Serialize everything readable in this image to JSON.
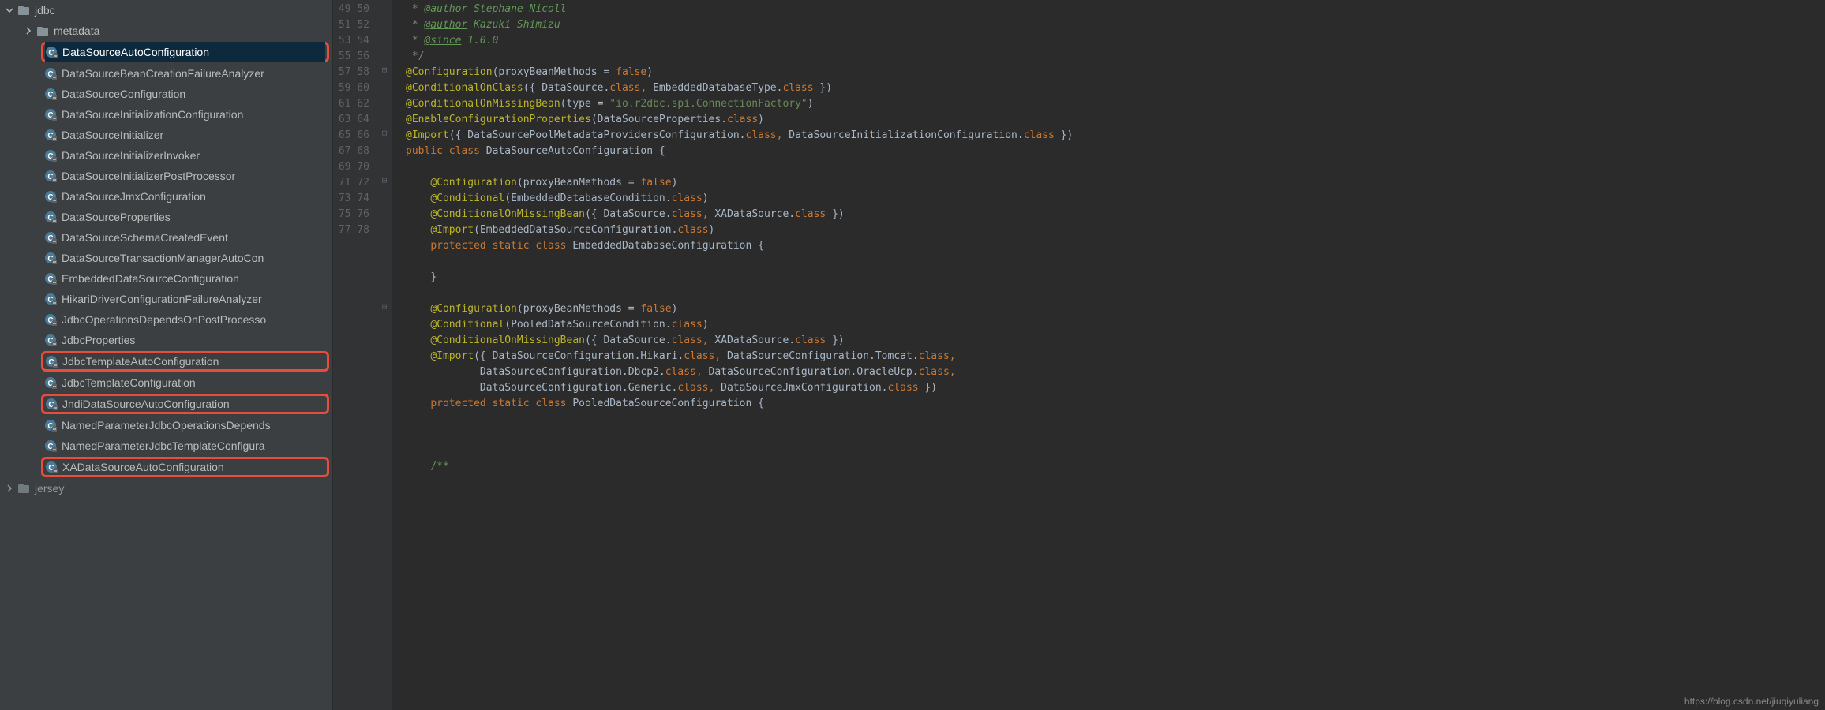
{
  "sidebar": {
    "root": {
      "label": "jdbc",
      "expanded": true
    },
    "folder": {
      "label": "metadata",
      "expanded": false
    },
    "items": [
      {
        "label": "DataSourceAutoConfiguration",
        "selected": true,
        "highlighted": true
      },
      {
        "label": "DataSourceBeanCreationFailureAnalyzer"
      },
      {
        "label": "DataSourceConfiguration"
      },
      {
        "label": "DataSourceInitializationConfiguration"
      },
      {
        "label": "DataSourceInitializer"
      },
      {
        "label": "DataSourceInitializerInvoker"
      },
      {
        "label": "DataSourceInitializerPostProcessor"
      },
      {
        "label": "DataSourceJmxConfiguration"
      },
      {
        "label": "DataSourceProperties"
      },
      {
        "label": "DataSourceSchemaCreatedEvent"
      },
      {
        "label": "DataSourceTransactionManagerAutoCon"
      },
      {
        "label": "EmbeddedDataSourceConfiguration"
      },
      {
        "label": "HikariDriverConfigurationFailureAnalyzer"
      },
      {
        "label": "JdbcOperationsDependsOnPostProcesso"
      },
      {
        "label": "JdbcProperties"
      },
      {
        "label": "JdbcTemplateAutoConfiguration",
        "highlighted": true
      },
      {
        "label": "JdbcTemplateConfiguration"
      },
      {
        "label": "JndiDataSourceAutoConfiguration",
        "highlighted": true
      },
      {
        "label": "NamedParameterJdbcOperationsDepends"
      },
      {
        "label": "NamedParameterJdbcTemplateConfigura"
      },
      {
        "label": "XADataSourceAutoConfiguration",
        "highlighted": true
      }
    ],
    "bottom": {
      "label": "jersey"
    }
  },
  "editor": {
    "startLine": 49,
    "endLine": 78,
    "code": {
      "l49": {
        "prefix": " * ",
        "tag": "@author",
        "val": " Stephane Nicoll"
      },
      "l50": {
        "prefix": " * ",
        "tag": "@author",
        "val": " Kazuki Shimizu"
      },
      "l51": {
        "prefix": " * ",
        "tag": "@since",
        "val": " 1.0.0"
      },
      "l52": " */",
      "l53": "@Configuration(proxyBeanMethods = false)",
      "l54": "@ConditionalOnClass({ DataSource.class, EmbeddedDatabaseType.class })",
      "l55": "@ConditionalOnMissingBean(type = \"io.r2dbc.spi.ConnectionFactory\")",
      "l56": "@EnableConfigurationProperties(DataSourceProperties.class)",
      "l57": "@Import({ DataSourcePoolMetadataProvidersConfiguration.class, DataSourceInitializationConfiguration.class })",
      "l58": "public class DataSourceAutoConfiguration {",
      "l60": "    @Configuration(proxyBeanMethods = false)",
      "l61": "    @Conditional(EmbeddedDatabaseCondition.class)",
      "l62": "    @ConditionalOnMissingBean({ DataSource.class, XADataSource.class })",
      "l63": "    @Import(EmbeddedDataSourceConfiguration.class)",
      "l64": "    protected static class EmbeddedDatabaseConfiguration {",
      "l66": "    }",
      "l68": "    @Configuration(proxyBeanMethods = false)",
      "l69": "    @Conditional(PooledDataSourceCondition.class)",
      "l70": "    @ConditionalOnMissingBean({ DataSource.class, XADataSource.class })",
      "l71": "    @Import({ DataSourceConfiguration.Hikari.class, DataSourceConfiguration.Tomcat.class,",
      "l72": "            DataSourceConfiguration.Dbcp2.class, DataSourceConfiguration.OracleUcp.class,",
      "l73": "            DataSourceConfiguration.Generic.class, DataSourceJmxConfiguration.class })",
      "l74": "    protected static class PooledDataSourceConfiguration {",
      "l78": "    /**"
    }
  },
  "watermark": "https://blog.csdn.net/jiuqiyuliang"
}
